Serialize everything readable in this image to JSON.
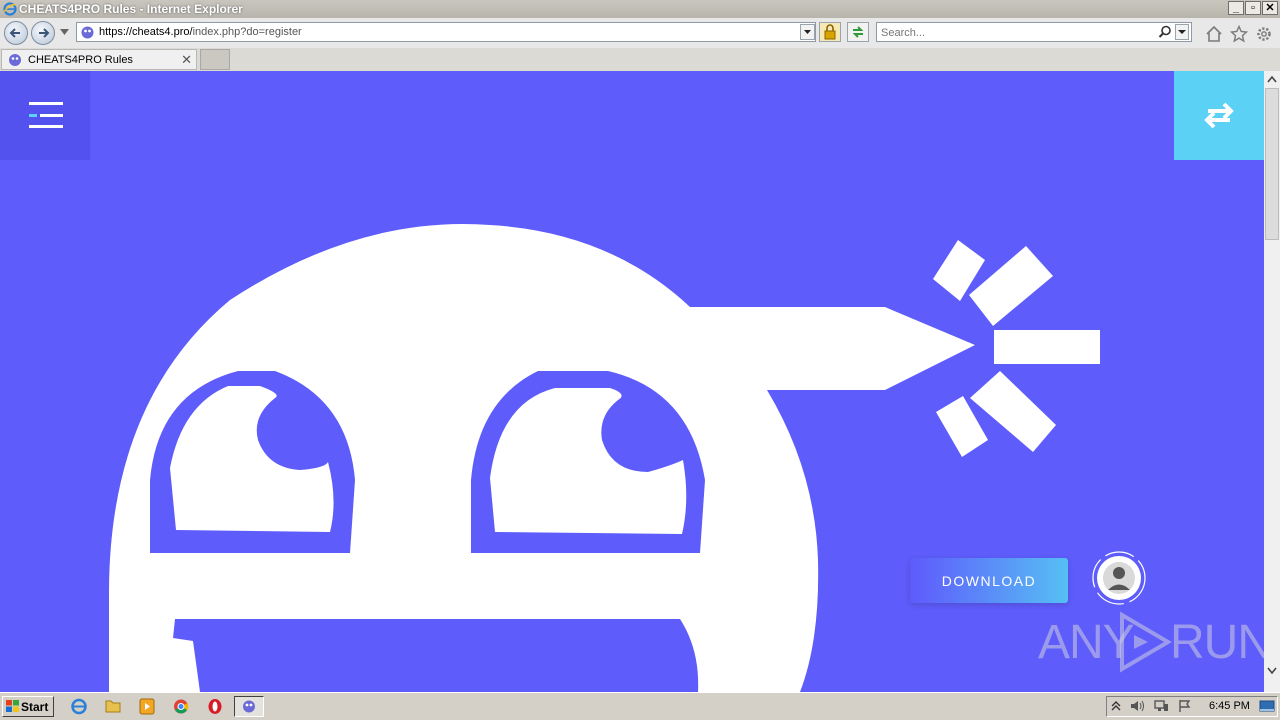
{
  "window": {
    "title": "CHEATS4PRO Rules - Internet Explorer",
    "minimize": "_",
    "maximize": "▫",
    "close": "✕"
  },
  "navbar": {
    "url_host": "https://cheats4.pro/",
    "url_path": "index.php?do=register",
    "search_placeholder": "Search..."
  },
  "tabs": [
    {
      "label": "CHEATS4PRO Rules",
      "close": "✕"
    }
  ],
  "page": {
    "background_color": "#5e5cfa",
    "swap_button_color": "#5ad1f5",
    "download_label": "DOWNLOAD",
    "mascot_color": "#ffffff"
  },
  "watermark": {
    "left": "ANY",
    "right": "RUN"
  },
  "taskbar": {
    "start_label": "Start",
    "apps": [
      "internet-explorer-icon",
      "file-explorer-icon",
      "media-player-icon",
      "chrome-icon",
      "opera-icon",
      "ie-page-icon"
    ],
    "clock": "6:45 PM"
  }
}
